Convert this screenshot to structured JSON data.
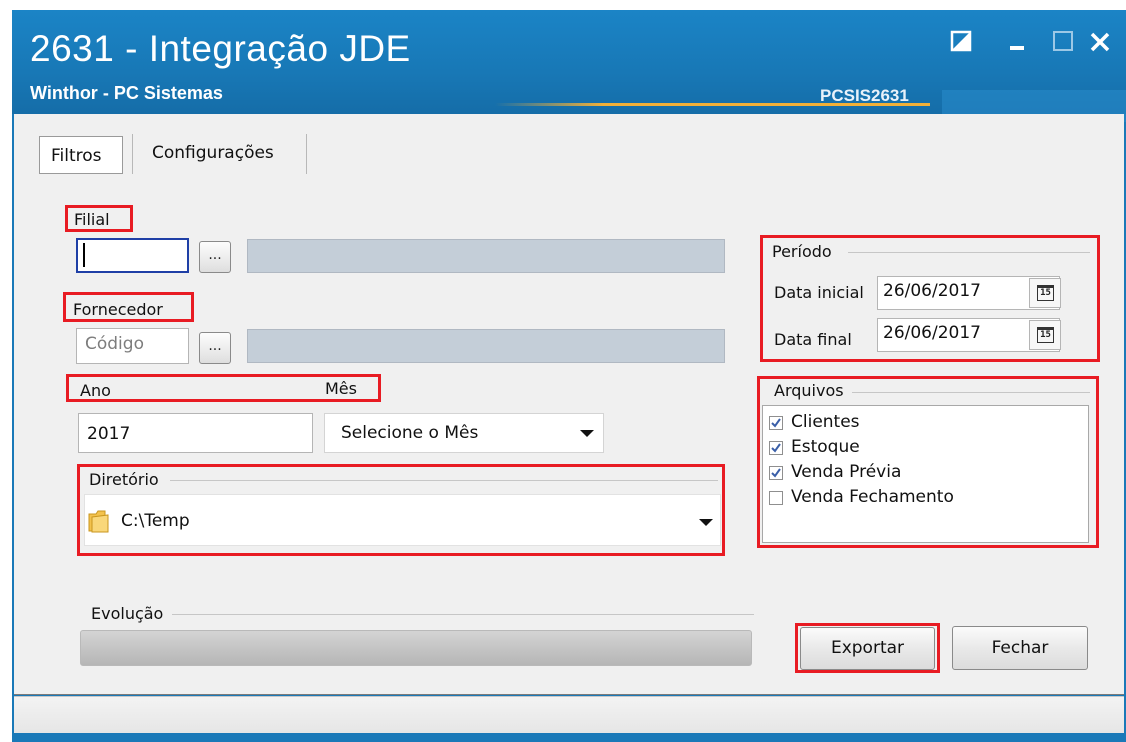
{
  "window": {
    "title": "2631 - Integração JDE",
    "subtitle": "Winthor - PC Sistemas",
    "program_code": "PCSIS2631"
  },
  "tabs": [
    {
      "label": "Filtros",
      "active": true
    },
    {
      "label": "Configurações",
      "active": false
    }
  ],
  "filial": {
    "label": "Filial",
    "value": "",
    "button_label": "..."
  },
  "fornecedor": {
    "label": "Fornecedor",
    "placeholder": "Código",
    "button_label": "..."
  },
  "ano": {
    "label": "Ano",
    "value": "2017"
  },
  "mes": {
    "label": "Mês",
    "selected": "Selecione o Mês"
  },
  "diretorio": {
    "label": "Diretório",
    "value": "C:\\Temp"
  },
  "periodo": {
    "label": "Período",
    "data_inicial_label": "Data inicial",
    "data_inicial_value": "26/06/2017",
    "data_final_label": "Data final",
    "data_final_value": "26/06/2017"
  },
  "arquivos": {
    "label": "Arquivos",
    "items": [
      {
        "label": "Clientes",
        "checked": true
      },
      {
        "label": "Estoque",
        "checked": true
      },
      {
        "label": "Venda Prévia",
        "checked": true
      },
      {
        "label": "Venda Fechamento",
        "checked": false
      }
    ]
  },
  "evolucao": {
    "label": "Evolução",
    "progress_percent": 0
  },
  "buttons": {
    "exportar": "Exportar",
    "fechar": "Fechar"
  },
  "colors": {
    "titlebar": "#1878b6",
    "highlight": "#e81b23",
    "accent": "#f2b038"
  }
}
